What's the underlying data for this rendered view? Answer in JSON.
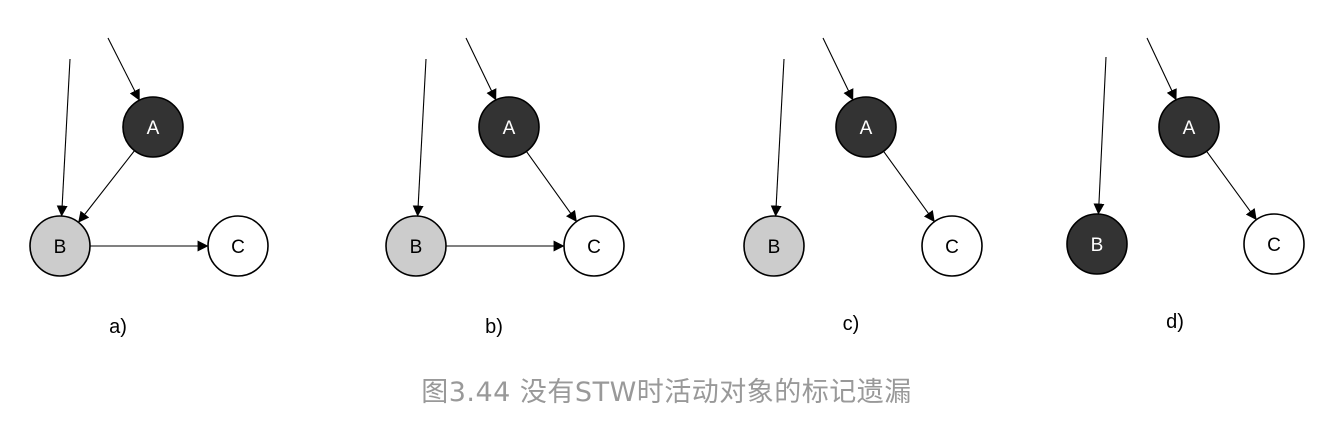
{
  "colors": {
    "black_node": "#333333",
    "gray_node": "#cccccc",
    "white_node": "#ffffff",
    "stroke": "#000000",
    "caption": "#999999"
  },
  "panels": [
    {
      "label": "a)",
      "nodes": [
        {
          "id": "A",
          "label": "A",
          "color": "black"
        },
        {
          "id": "B",
          "label": "B",
          "color": "gray"
        },
        {
          "id": "C",
          "label": "C",
          "color": "white"
        }
      ],
      "edges": [
        {
          "from": "root",
          "to": "A"
        },
        {
          "from": "root",
          "to": "B"
        },
        {
          "from": "A",
          "to": "B"
        },
        {
          "from": "B",
          "to": "C"
        }
      ]
    },
    {
      "label": "b)",
      "nodes": [
        {
          "id": "A",
          "label": "A",
          "color": "black"
        },
        {
          "id": "B",
          "label": "B",
          "color": "gray"
        },
        {
          "id": "C",
          "label": "C",
          "color": "white"
        }
      ],
      "edges": [
        {
          "from": "root",
          "to": "A"
        },
        {
          "from": "root",
          "to": "B"
        },
        {
          "from": "A",
          "to": "C"
        },
        {
          "from": "B",
          "to": "C"
        }
      ]
    },
    {
      "label": "c)",
      "nodes": [
        {
          "id": "A",
          "label": "A",
          "color": "black"
        },
        {
          "id": "B",
          "label": "B",
          "color": "gray"
        },
        {
          "id": "C",
          "label": "C",
          "color": "white"
        }
      ],
      "edges": [
        {
          "from": "root",
          "to": "A"
        },
        {
          "from": "root",
          "to": "B"
        },
        {
          "from": "A",
          "to": "C"
        }
      ]
    },
    {
      "label": "d)",
      "nodes": [
        {
          "id": "A",
          "label": "A",
          "color": "black"
        },
        {
          "id": "B",
          "label": "B",
          "color": "black"
        },
        {
          "id": "C",
          "label": "C",
          "color": "white"
        }
      ],
      "edges": [
        {
          "from": "root",
          "to": "A"
        },
        {
          "from": "root",
          "to": "B"
        },
        {
          "from": "A",
          "to": "C"
        }
      ]
    }
  ],
  "caption": "图3.44 没有STW时活动对象的标记遗漏"
}
